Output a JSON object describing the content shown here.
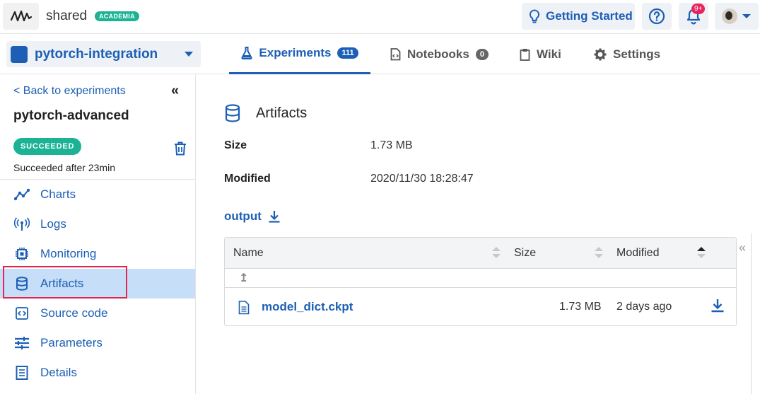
{
  "topbar": {
    "org_name": "shared",
    "org_badge": "ACADEMIA",
    "getting_started": "Getting Started",
    "notifications_badge": "9+",
    "logo_icon": "wave-logo-icon",
    "help_icon": "question-circle-icon",
    "bell_icon": "bell-icon"
  },
  "project": {
    "name": "pytorch-integration"
  },
  "tabs": [
    {
      "label": "Experiments",
      "count": "111",
      "icon": "flask-icon",
      "active": true
    },
    {
      "label": "Notebooks",
      "count": "0",
      "icon": "notebook-icon",
      "active": false
    },
    {
      "label": "Wiki",
      "icon": "clipboard-icon",
      "active": false
    },
    {
      "label": "Settings",
      "icon": "gear-icon",
      "active": false
    }
  ],
  "sidebar": {
    "back_link": "< Back to experiments",
    "collapse": "«",
    "experiment_name": "pytorch-advanced",
    "status": "SUCCEEDED",
    "status_text": "Succeeded after 23min",
    "items": [
      {
        "label": "Charts",
        "icon": "chart-icon"
      },
      {
        "label": "Logs",
        "icon": "broadcast-icon"
      },
      {
        "label": "Monitoring",
        "icon": "chip-icon"
      },
      {
        "label": "Artifacts",
        "icon": "database-icon",
        "active": true
      },
      {
        "label": "Source code",
        "icon": "code-icon"
      },
      {
        "label": "Parameters",
        "icon": "sliders-icon"
      },
      {
        "label": "Details",
        "icon": "document-icon"
      }
    ]
  },
  "main": {
    "title": "Artifacts",
    "size_label": "Size",
    "size_value": "1.73 MB",
    "modified_label": "Modified",
    "modified_value": "2020/11/30 18:28:47",
    "folder_link": "output",
    "table": {
      "columns": [
        "Name",
        "Size",
        "Modified"
      ],
      "parent": "↥",
      "rows": [
        {
          "name": "model_dict.ckpt",
          "size": "1.73 MB",
          "modified": "2 days ago"
        }
      ]
    },
    "right_collapse": "«"
  },
  "colors": {
    "accent": "#1c5fb5",
    "success": "#1bb394",
    "alert": "#e8265e",
    "active_bg": "#c6def7"
  }
}
